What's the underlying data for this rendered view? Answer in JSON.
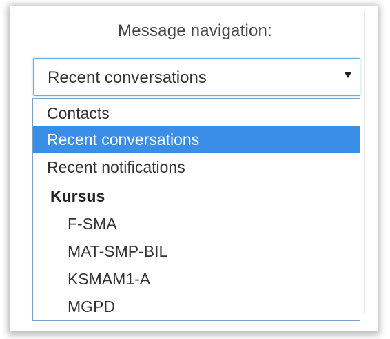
{
  "navigation": {
    "title": "Message navigation:",
    "selected_value": "Recent conversations",
    "options": [
      {
        "label": "Contacts",
        "selected": false
      },
      {
        "label": "Recent conversations",
        "selected": true
      },
      {
        "label": "Recent notifications",
        "selected": false
      }
    ],
    "group": {
      "label": "Kursus",
      "options": [
        {
          "label": "F-SMA"
        },
        {
          "label": "MAT-SMP-BIL"
        },
        {
          "label": "KSMAM1-A"
        },
        {
          "label": "MGPD"
        }
      ]
    }
  },
  "colors": {
    "highlight": "#3a8ee6",
    "focus_border": "#66afe9"
  },
  "icons": {
    "select_arrow": "caret-down-icon"
  }
}
